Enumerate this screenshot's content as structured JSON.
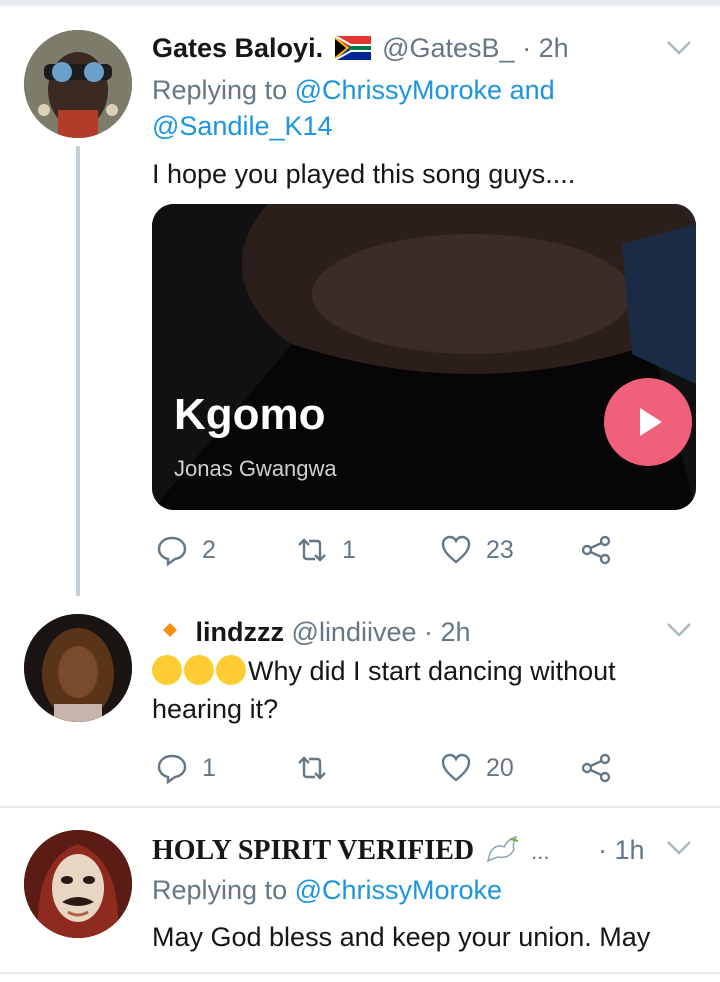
{
  "colors": {
    "link": "#1b95e0",
    "secondary": "#657786",
    "play": "#f0607a"
  },
  "tweets": [
    {
      "name": "Gates Baloyi.",
      "flag_icon": "south-africa-flag-icon",
      "handle": "@GatesB_",
      "time": "· 2h",
      "replying_prefix": "Replying to",
      "mention1": "@ChrissyMoroke",
      "and": "and",
      "mention2": "@Sandile_K14",
      "text": "I hope you played this song guys....",
      "card": {
        "title": "Kgomo",
        "artist": "Jonas Gwangwa"
      },
      "replies": "2",
      "retweets": "1",
      "likes": "23"
    },
    {
      "name": "lindzzz",
      "badge_icon": "orange-diamond-icon",
      "handle": "@lindiivee",
      "time": "· 2h",
      "emoji_icon": "loudly-crying-face-icon",
      "text_line1": "Why did I start dancing without",
      "text_line2": "hearing it?",
      "replies": "1",
      "retweets": "",
      "likes": "20"
    },
    {
      "name": "HOLY SPIRIT VERIFIED",
      "dove_icon": "dove-icon",
      "ellipsis": "...",
      "time": "· 1h",
      "replying_prefix": "Replying to",
      "mention1": "@ChrissyMoroke",
      "text": "May God bless and keep your union. May"
    }
  ]
}
